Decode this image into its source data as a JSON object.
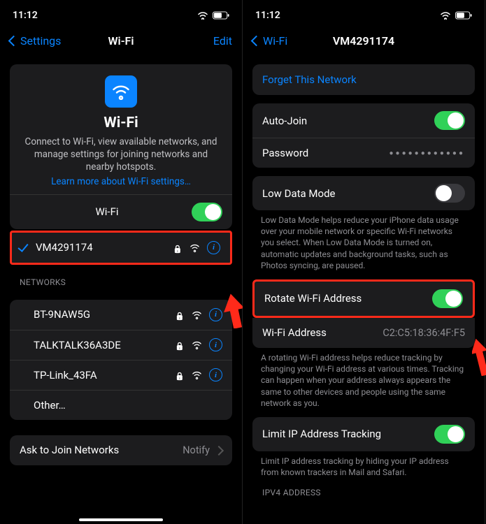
{
  "status": {
    "time": "11:12"
  },
  "left": {
    "nav": {
      "back": "Settings",
      "title": "Wi-Fi",
      "right": "Edit"
    },
    "header": {
      "title": "Wi-Fi",
      "desc": "Connect to Wi-Fi, view available networks, and manage settings for joining networks and nearby hotspots.",
      "link": "Learn more about Wi-Fi settings…"
    },
    "wifi_toggle_label": "Wi-Fi",
    "connected": "VM4291174",
    "section_networks": "NETWORKS",
    "networks": {
      "n0": "BT-9NAW5G",
      "n1": "TALKTALK36A3DE",
      "n2": "TP-Link_43FA",
      "other": "Other…"
    },
    "ask": {
      "label": "Ask to Join Networks",
      "value": "Notify"
    }
  },
  "right": {
    "nav": {
      "back": "Wi-Fi",
      "title": "VM4291174"
    },
    "forget": "Forget This Network",
    "auto_join": "Auto-Join",
    "password": "Password",
    "low_data": "Low Data Mode",
    "low_data_desc": "Low Data Mode helps reduce your iPhone data usage over your mobile network or specific Wi-Fi networks you select. When Low Data Mode is turned on, automatic updates and background tasks, such as Photos syncing, are paused.",
    "rotate": "Rotate Wi-Fi Address",
    "wifi_addr_label": "Wi-Fi Address",
    "wifi_addr_value": "C2:C5:18:36:4F:F5",
    "rotate_desc": "A rotating Wi-Fi address helps reduce tracking by changing your Wi-Fi address at various times. Tracking can happen when your address always appears the same to other devices and people using the same network as you.",
    "limit_ip": "Limit IP Address Tracking",
    "limit_ip_desc": "Limit IP address tracking by hiding your IP address from known trackers in Mail and Safari.",
    "ipv4": "IPV4 ADDRESS"
  }
}
